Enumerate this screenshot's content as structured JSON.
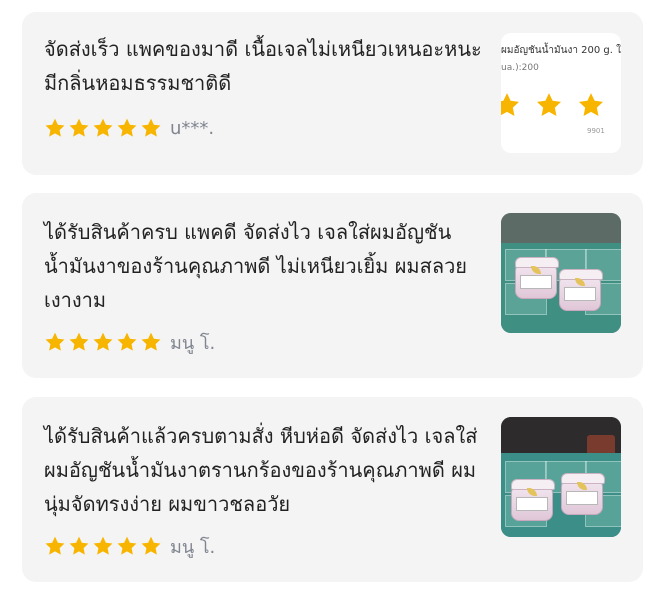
{
  "reviews": [
    {
      "text": "จัดส่งเร็ว แพคของมาดี เนื้อเจลไม่เหนียวเหนอะหนะ มีกลิ่นหอมธรรมชาติดี",
      "rating": 5,
      "reviewer": "u***.",
      "thumbnail": {
        "title": "ผมอัญชันน้ำมันงา 200 g. ใ",
        "subtitle": "ua.):200",
        "footer": "9901"
      }
    },
    {
      "text": "ได้รับสินค้าครบ แพคดี จัดส่งไว เจลใส่ผมอัญชันน้ำมันงาของร้านคุณภาพดี ไม่เหนียวเยิ้ม ผมสลวยเงางาม",
      "rating": 5,
      "reviewer": "มนู โ."
    },
    {
      "text": "ได้รับสินค้าแล้วครบตามสั่ง หีบห่อดี จัดส่งไว เจลใส่ผมอัญชันน้ำมันงาตรานกร้องของร้านคุณภาพดี ผมนุ่มจัดทรงง่าย ผมขาวชลอวัย",
      "rating": 5,
      "reviewer": "มนู โ."
    }
  ],
  "colors": {
    "card_background": "#f4f4f4",
    "star": "#f7b500",
    "text": "#222222",
    "reviewer": "#808590"
  },
  "icons": {
    "star": "star-icon"
  }
}
